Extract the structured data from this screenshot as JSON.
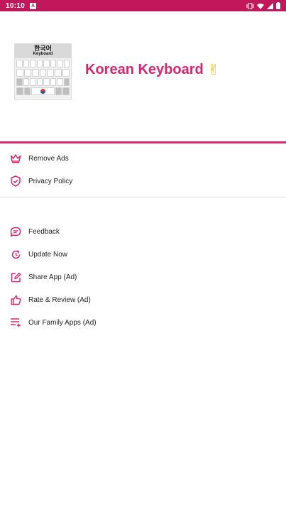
{
  "status_bar": {
    "time": "10:10",
    "notification_letter": "A",
    "icons": [
      "vibrate-icon",
      "wifi-icon",
      "signal-icon",
      "battery-icon"
    ]
  },
  "header": {
    "title": "Korean Keyboard",
    "title_emoji": "✌",
    "logo": {
      "top_text": "한국어",
      "sub_text": "Keyboard"
    }
  },
  "menu_group_1": [
    {
      "icon": "crown-icon",
      "label": "Remove Ads"
    },
    {
      "icon": "shield-check-icon",
      "label": "Privacy Policy"
    }
  ],
  "menu_group_2": [
    {
      "icon": "chat-icon",
      "label": "Feedback"
    },
    {
      "icon": "refresh-icon",
      "label": "Update Now"
    },
    {
      "icon": "share-edit-icon",
      "label": "Share App (Ad)"
    },
    {
      "icon": "thumbs-up-icon",
      "label": "Rate & Review (Ad)"
    },
    {
      "icon": "playlist-add-icon",
      "label": "Our Family Apps (Ad)"
    }
  ],
  "colors": {
    "accent": "#d6286e",
    "status_bar": "#c2185b"
  }
}
